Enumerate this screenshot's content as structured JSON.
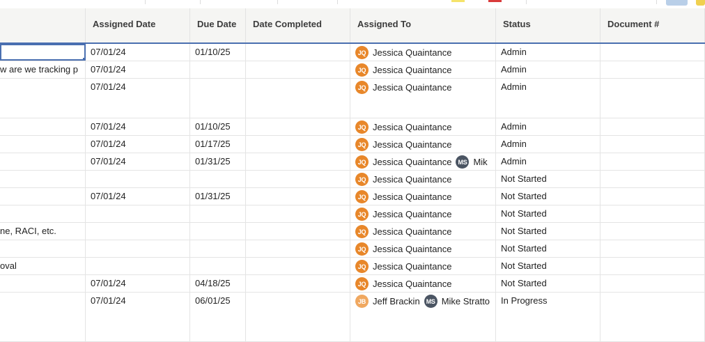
{
  "columns": [
    {
      "key": "task",
      "label": ""
    },
    {
      "key": "assigned_date",
      "label": "Assigned Date"
    },
    {
      "key": "due_date",
      "label": "Due Date"
    },
    {
      "key": "date_completed",
      "label": "Date Completed"
    },
    {
      "key": "assigned_to",
      "label": "Assigned To"
    },
    {
      "key": "status",
      "label": "Status"
    },
    {
      "key": "document",
      "label": "Document #"
    }
  ],
  "avatar_colors": {
    "JQ": "#e8872a",
    "MS": "#4b5563",
    "JB": "#f0a860"
  },
  "toolbar_colors": {
    "highlight": "#f5e36a",
    "red_marker": "#d93b3b",
    "button": "#b9cfe8",
    "button_edge": "#f0d050"
  },
  "rows": [
    {
      "task": "",
      "assigned_date": "07/01/24",
      "due_date": "01/10/25",
      "date_completed": "",
      "assignees": [
        {
          "initials": "JQ",
          "name": "Jessica Quaintance"
        }
      ],
      "status": "Admin",
      "document": ""
    },
    {
      "task": "w are we tracking p",
      "assigned_date": "07/01/24",
      "due_date": "",
      "date_completed": "",
      "assignees": [
        {
          "initials": "JQ",
          "name": "Jessica Quaintance"
        }
      ],
      "status": "Admin",
      "document": ""
    },
    {
      "task": "",
      "assigned_date": "07/01/24",
      "due_date": "",
      "date_completed": "",
      "assignees": [
        {
          "initials": "JQ",
          "name": "Jessica Quaintance"
        }
      ],
      "status": "Admin",
      "document": ""
    },
    {
      "task": "",
      "assigned_date": "07/01/24",
      "due_date": "01/10/25",
      "date_completed": "",
      "assignees": [
        {
          "initials": "JQ",
          "name": "Jessica Quaintance"
        }
      ],
      "status": "Admin",
      "document": ""
    },
    {
      "task": "",
      "assigned_date": "07/01/24",
      "due_date": "01/17/25",
      "date_completed": "",
      "assignees": [
        {
          "initials": "JQ",
          "name": "Jessica Quaintance"
        }
      ],
      "status": "Admin",
      "document": ""
    },
    {
      "task": "",
      "assigned_date": "07/01/24",
      "due_date": "01/31/25",
      "date_completed": "",
      "assignees": [
        {
          "initials": "JQ",
          "name": "Jessica Quaintance"
        },
        {
          "initials": "MS",
          "name": "Mik"
        }
      ],
      "status": "Admin",
      "document": ""
    },
    {
      "task": "",
      "assigned_date": "",
      "due_date": "",
      "date_completed": "",
      "assignees": [
        {
          "initials": "JQ",
          "name": "Jessica Quaintance"
        }
      ],
      "status": "Not Started",
      "document": ""
    },
    {
      "task": "",
      "assigned_date": "07/01/24",
      "due_date": "01/31/25",
      "date_completed": "",
      "assignees": [
        {
          "initials": "JQ",
          "name": "Jessica Quaintance"
        }
      ],
      "status": "Not Started",
      "document": ""
    },
    {
      "task": "",
      "assigned_date": "",
      "due_date": "",
      "date_completed": "",
      "assignees": [
        {
          "initials": "JQ",
          "name": "Jessica Quaintance"
        }
      ],
      "status": "Not Started",
      "document": ""
    },
    {
      "task": "ne, RACI, etc.",
      "assigned_date": "",
      "due_date": "",
      "date_completed": "",
      "assignees": [
        {
          "initials": "JQ",
          "name": "Jessica Quaintance"
        }
      ],
      "status": "Not Started",
      "document": ""
    },
    {
      "task": "",
      "assigned_date": "",
      "due_date": "",
      "date_completed": "",
      "assignees": [
        {
          "initials": "JQ",
          "name": "Jessica Quaintance"
        }
      ],
      "status": "Not Started",
      "document": ""
    },
    {
      "task": "oval",
      "assigned_date": "",
      "due_date": "",
      "date_completed": "",
      "assignees": [
        {
          "initials": "JQ",
          "name": "Jessica Quaintance"
        }
      ],
      "status": "Not Started",
      "document": ""
    },
    {
      "task": "",
      "assigned_date": "07/01/24",
      "due_date": "04/18/25",
      "date_completed": "",
      "assignees": [
        {
          "initials": "JQ",
          "name": "Jessica Quaintance"
        }
      ],
      "status": "Not Started",
      "document": ""
    },
    {
      "task": "",
      "assigned_date": "07/01/24",
      "due_date": "06/01/25",
      "date_completed": "",
      "assignees": [
        {
          "initials": "JB",
          "name": "Jeff Brackin"
        },
        {
          "initials": "MS",
          "name": "Mike Stratto"
        }
      ],
      "status": "In Progress",
      "document": ""
    }
  ]
}
